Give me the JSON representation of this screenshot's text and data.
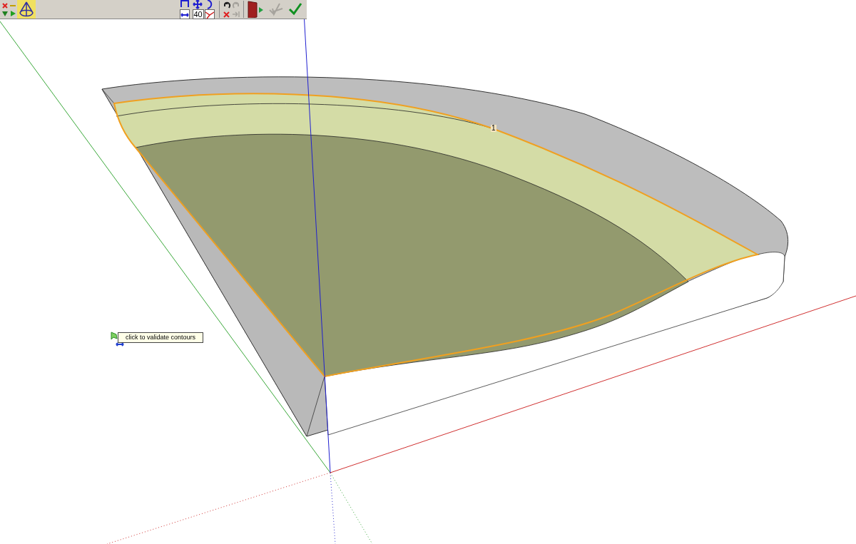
{
  "toolbar": {
    "buttons": [
      {
        "kind": "cancel",
        "disabled": false
      },
      {
        "kind": "minus",
        "disabled": false
      },
      {
        "kind": "down",
        "disabled": false
      },
      {
        "kind": "play",
        "disabled": false
      },
      {
        "kind": "shape",
        "disabled": false
      },
      {
        "kind": "frame",
        "disabled": false
      },
      {
        "kind": "move",
        "disabled": false
      },
      {
        "kind": "arc",
        "disabled": false
      },
      {
        "kind": "width",
        "disabled": false
      },
      {
        "kind": "field",
        "value": "40"
      },
      {
        "kind": "angle",
        "disabled": false
      },
      {
        "kind": "undo",
        "disabled": false
      },
      {
        "kind": "redo",
        "disabled": true
      },
      {
        "kind": "delete",
        "disabled": false
      },
      {
        "kind": "end",
        "disabled": true
      },
      {
        "kind": "exit",
        "disabled": false
      },
      {
        "kind": "back",
        "disabled": true
      },
      {
        "kind": "validate",
        "disabled": false
      }
    ]
  },
  "scene": {
    "vertex_label": "1"
  },
  "tooltip": {
    "text": "click to validate contours"
  }
}
